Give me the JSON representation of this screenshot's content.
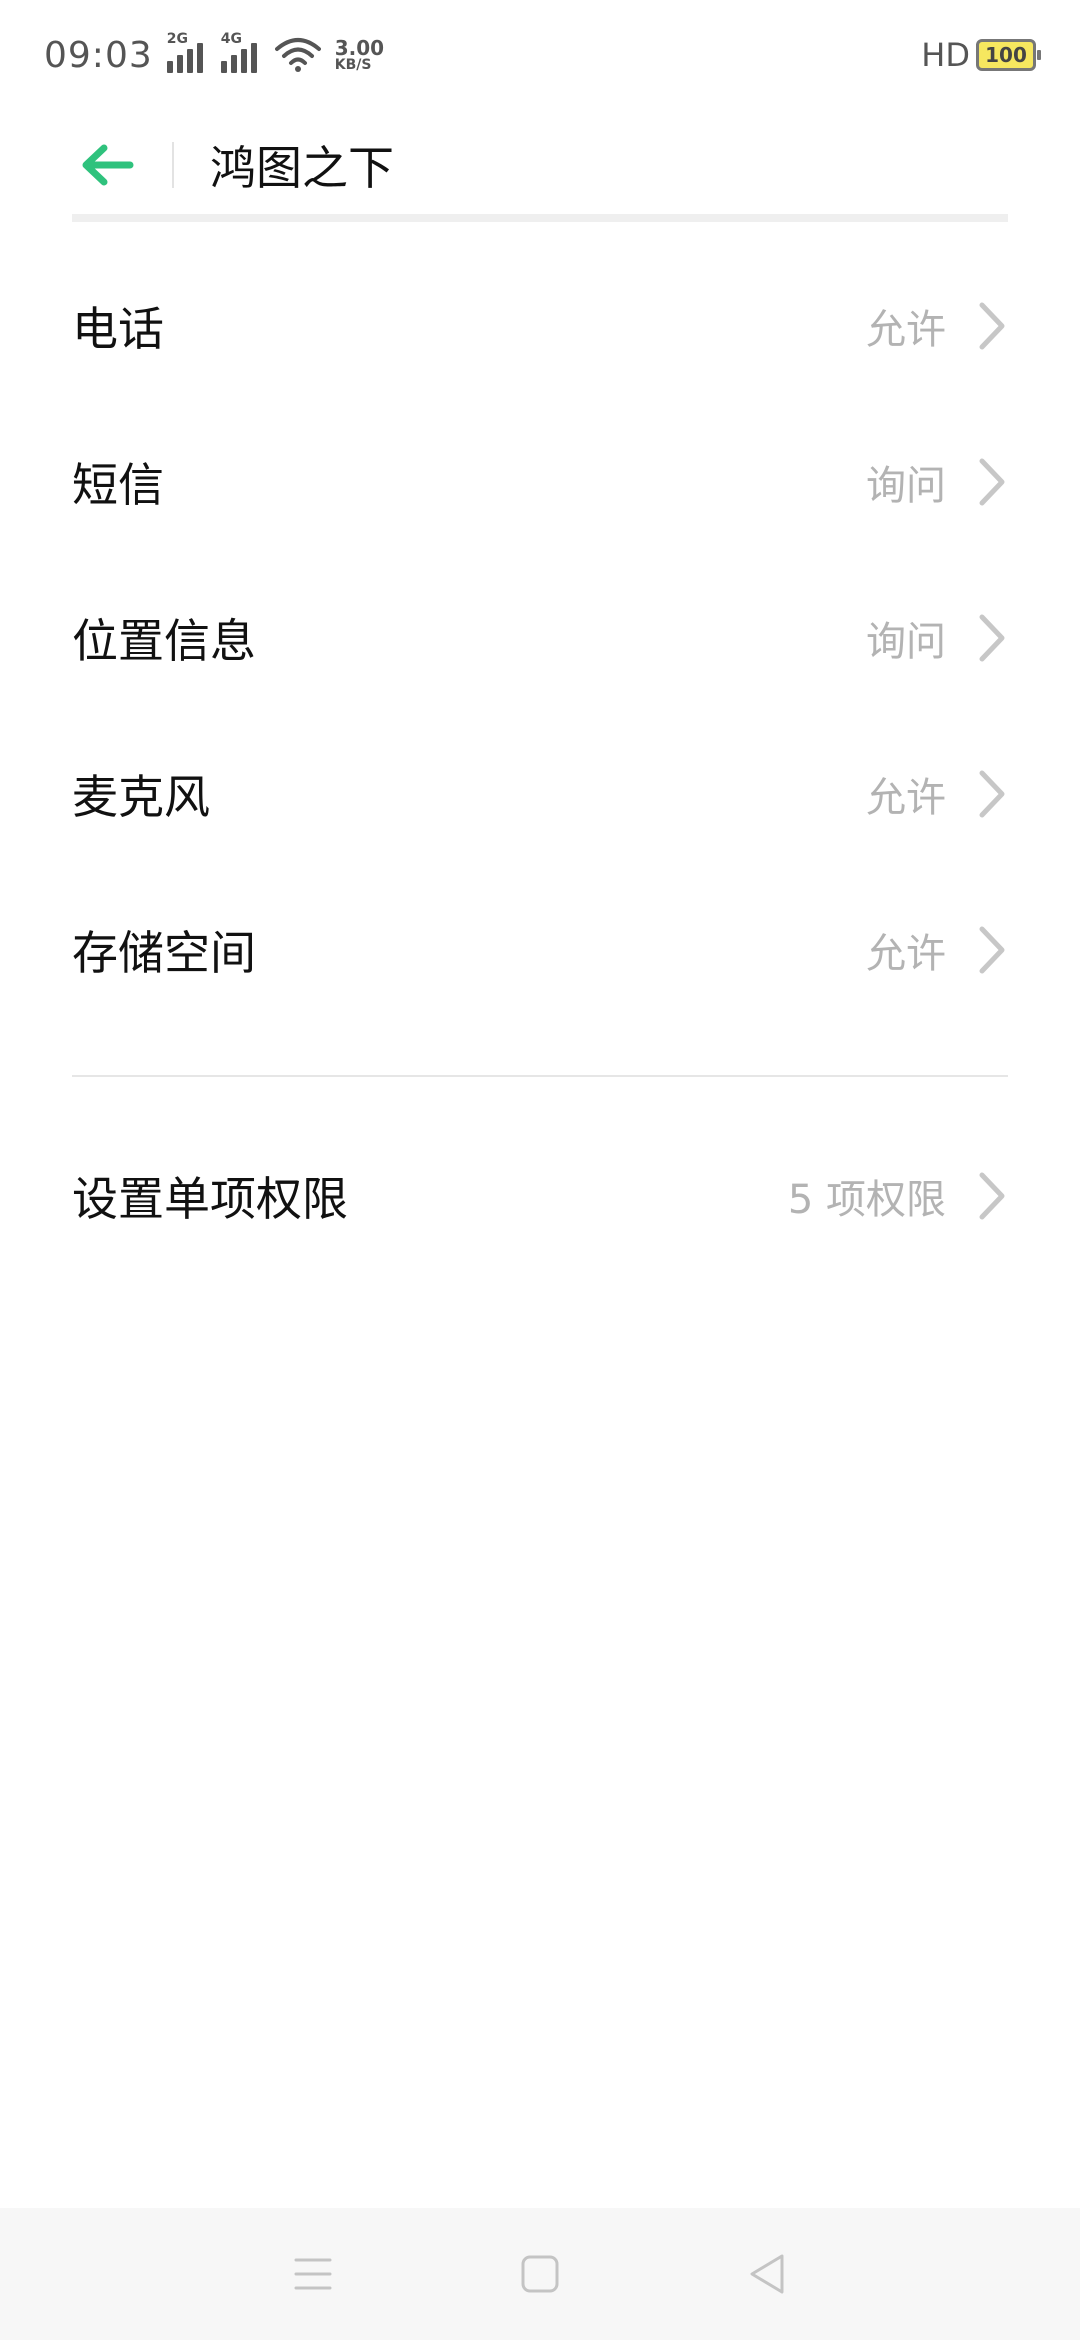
{
  "status_bar": {
    "time": "09:03",
    "signal1_tag": "2G",
    "signal2_tag": "4G",
    "net_speed_value": "3.00",
    "net_speed_unit": "KB/S",
    "hd": "HD",
    "battery": "100"
  },
  "header": {
    "title": "鸿图之下",
    "accent_color": "#2fc27d"
  },
  "permissions": [
    {
      "label": "电话",
      "value": "允许"
    },
    {
      "label": "短信",
      "value": "询问"
    },
    {
      "label": "位置信息",
      "value": "询问"
    },
    {
      "label": "麦克风",
      "value": "允许"
    },
    {
      "label": "存储空间",
      "value": "允许"
    }
  ],
  "single_permission": {
    "label": "设置单项权限",
    "value": "5 项权限"
  },
  "nav": {
    "menu_icon": "menu-icon",
    "home_icon": "home-icon",
    "back_icon": "back-triangle-icon"
  }
}
